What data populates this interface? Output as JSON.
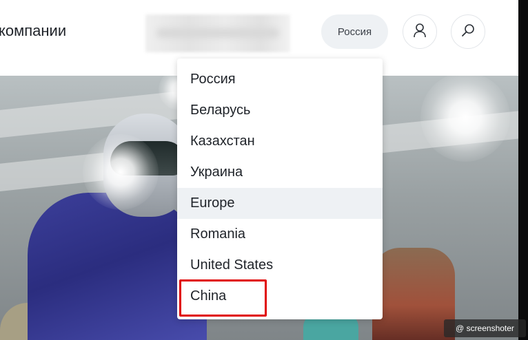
{
  "header": {
    "company_link": "компании",
    "country_button": "Россия",
    "profile_icon": "user-icon",
    "search_icon": "search-icon"
  },
  "dropdown": {
    "items": [
      {
        "label": "Россия"
      },
      {
        "label": "Беларусь"
      },
      {
        "label": "Казахстан"
      },
      {
        "label": "Украина"
      },
      {
        "label": "Europe"
      },
      {
        "label": "Romania"
      },
      {
        "label": "United States"
      },
      {
        "label": "China"
      }
    ],
    "hovered_item": "Europe",
    "highlighted_item": "China"
  },
  "watermark": {
    "text": "@ screenshoter"
  },
  "colors": {
    "highlight_border": "#e00000",
    "hover_background": "#eef1f4",
    "text": "#1f2329"
  }
}
